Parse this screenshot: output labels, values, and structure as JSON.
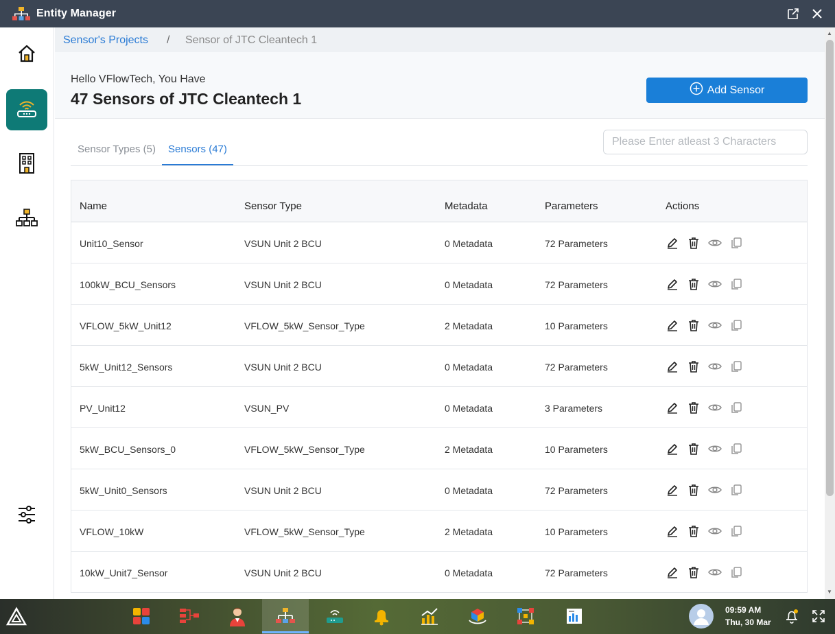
{
  "window": {
    "title": "Entity Manager"
  },
  "breadcrumb": {
    "parent": "Sensor's Projects",
    "separator": "/",
    "current": "Sensor of JTC Cleantech 1"
  },
  "header": {
    "greeting": "Hello VFlowTech, You Have",
    "title": "47 Sensors of JTC Cleantech 1",
    "add_button_label": "Add Sensor"
  },
  "tabs": [
    {
      "label": "Sensor Types (5)",
      "active": false
    },
    {
      "label": "Sensors (47)",
      "active": true
    }
  ],
  "search": {
    "placeholder": "Please Enter atleast 3 Characters",
    "value": ""
  },
  "table": {
    "columns": [
      "Name",
      "Sensor Type",
      "Metadata",
      "Parameters",
      "Actions"
    ],
    "rows": [
      {
        "name": "Unit10_Sensor",
        "type": "VSUN Unit 2 BCU",
        "metadata": "0 Metadata",
        "parameters": "72 Parameters"
      },
      {
        "name": "100kW_BCU_Sensors",
        "type": "VSUN Unit 2 BCU",
        "metadata": "0 Metadata",
        "parameters": "72 Parameters"
      },
      {
        "name": "VFLOW_5kW_Unit12",
        "type": "VFLOW_5kW_Sensor_Type",
        "metadata": "2 Metadata",
        "parameters": "10 Parameters"
      },
      {
        "name": "5kW_Unit12_Sensors",
        "type": "VSUN Unit 2 BCU",
        "metadata": "0 Metadata",
        "parameters": "72 Parameters"
      },
      {
        "name": "PV_Unit12",
        "type": "VSUN_PV",
        "metadata": "0 Metadata",
        "parameters": "3 Parameters"
      },
      {
        "name": "5kW_BCU_Sensors_0",
        "type": "VFLOW_5kW_Sensor_Type",
        "metadata": "2 Metadata",
        "parameters": "10 Parameters"
      },
      {
        "name": "5kW_Unit0_Sensors",
        "type": "VSUN Unit 2 BCU",
        "metadata": "0 Metadata",
        "parameters": "72 Parameters"
      },
      {
        "name": "VFLOW_10kW",
        "type": "VFLOW_5kW_Sensor_Type",
        "metadata": "2 Metadata",
        "parameters": "10 Parameters"
      },
      {
        "name": "10kW_Unit7_Sensor",
        "type": "VSUN Unit 2 BCU",
        "metadata": "0 Metadata",
        "parameters": "72 Parameters"
      }
    ]
  },
  "rail": {
    "items": [
      {
        "icon": "home-icon",
        "active": false
      },
      {
        "icon": "router-icon",
        "active": true
      },
      {
        "icon": "building-icon",
        "active": false
      },
      {
        "icon": "hierarchy-icon",
        "active": false
      },
      {
        "icon": "sliders-icon",
        "active": false
      }
    ]
  },
  "taskbar": {
    "time": "09:59 AM",
    "date": "Thu, 30 Mar"
  },
  "colors": {
    "titlebar": "#3b4554",
    "accent": "#2a7bd5",
    "button": "#1a7fd8",
    "active_rail": "#0e7a76"
  }
}
